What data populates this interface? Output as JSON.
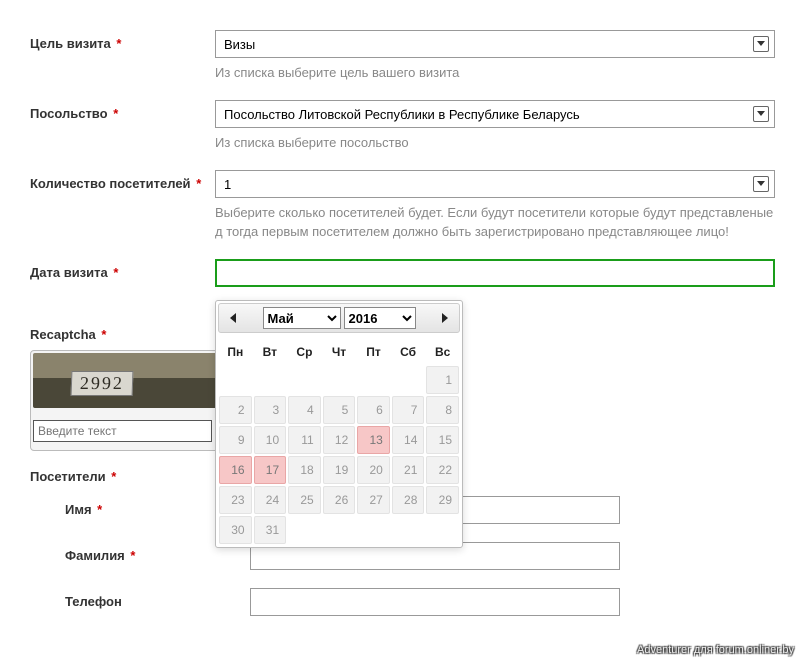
{
  "form": {
    "purpose": {
      "label": "Цель визита",
      "value": "Визы",
      "hint": "Из списка выберите цель вашего визита"
    },
    "embassy": {
      "label": "Посольство",
      "value": "Посольство Литовской Республики в Республике Беларусь",
      "hint": "Из списка выберите посольство"
    },
    "visitors_count": {
      "label": "Количество посетителей",
      "value": "1",
      "hint": "Выберите сколько посетителей будет. Если будут посетители которые будут представленые д тогда первым посетителем должно быть зарегистрировано представляющее лицо!"
    },
    "visit_date": {
      "label": "Дата визита",
      "value": ""
    },
    "recaptcha": {
      "label": "Recaptcha",
      "image_text": "2992",
      "placeholder": "Введите текст"
    },
    "visitors_section": {
      "label": "Посетители",
      "fields": {
        "first_name": {
          "label": "Имя"
        },
        "last_name": {
          "label": "Фамилия"
        },
        "phone": {
          "label": "Телефон"
        }
      }
    }
  },
  "datepicker": {
    "month": "Май",
    "year": "2016",
    "day_headers": [
      "Пн",
      "Вт",
      "Ср",
      "Чт",
      "Пт",
      "Сб",
      "Вс"
    ],
    "weeks": [
      [
        null,
        null,
        null,
        null,
        null,
        null,
        {
          "d": 1
        }
      ],
      [
        {
          "d": 2
        },
        {
          "d": 3
        },
        {
          "d": 4
        },
        {
          "d": 5
        },
        {
          "d": 6
        },
        {
          "d": 7
        },
        {
          "d": 8
        }
      ],
      [
        {
          "d": 9
        },
        {
          "d": 10
        },
        {
          "d": 11
        },
        {
          "d": 12
        },
        {
          "d": 13,
          "hl": true
        },
        {
          "d": 14
        },
        {
          "d": 15
        }
      ],
      [
        {
          "d": 16,
          "hl": true
        },
        {
          "d": 17,
          "hl": true
        },
        {
          "d": 18
        },
        {
          "d": 19
        },
        {
          "d": 20
        },
        {
          "d": 21
        },
        {
          "d": 22
        }
      ],
      [
        {
          "d": 23
        },
        {
          "d": 24
        },
        {
          "d": 25
        },
        {
          "d": 26
        },
        {
          "d": 27
        },
        {
          "d": 28
        },
        {
          "d": 29
        }
      ],
      [
        {
          "d": 30
        },
        {
          "d": 31
        },
        null,
        null,
        null,
        null,
        null
      ]
    ]
  },
  "watermark": "Adventurer для forum.onliner.by"
}
